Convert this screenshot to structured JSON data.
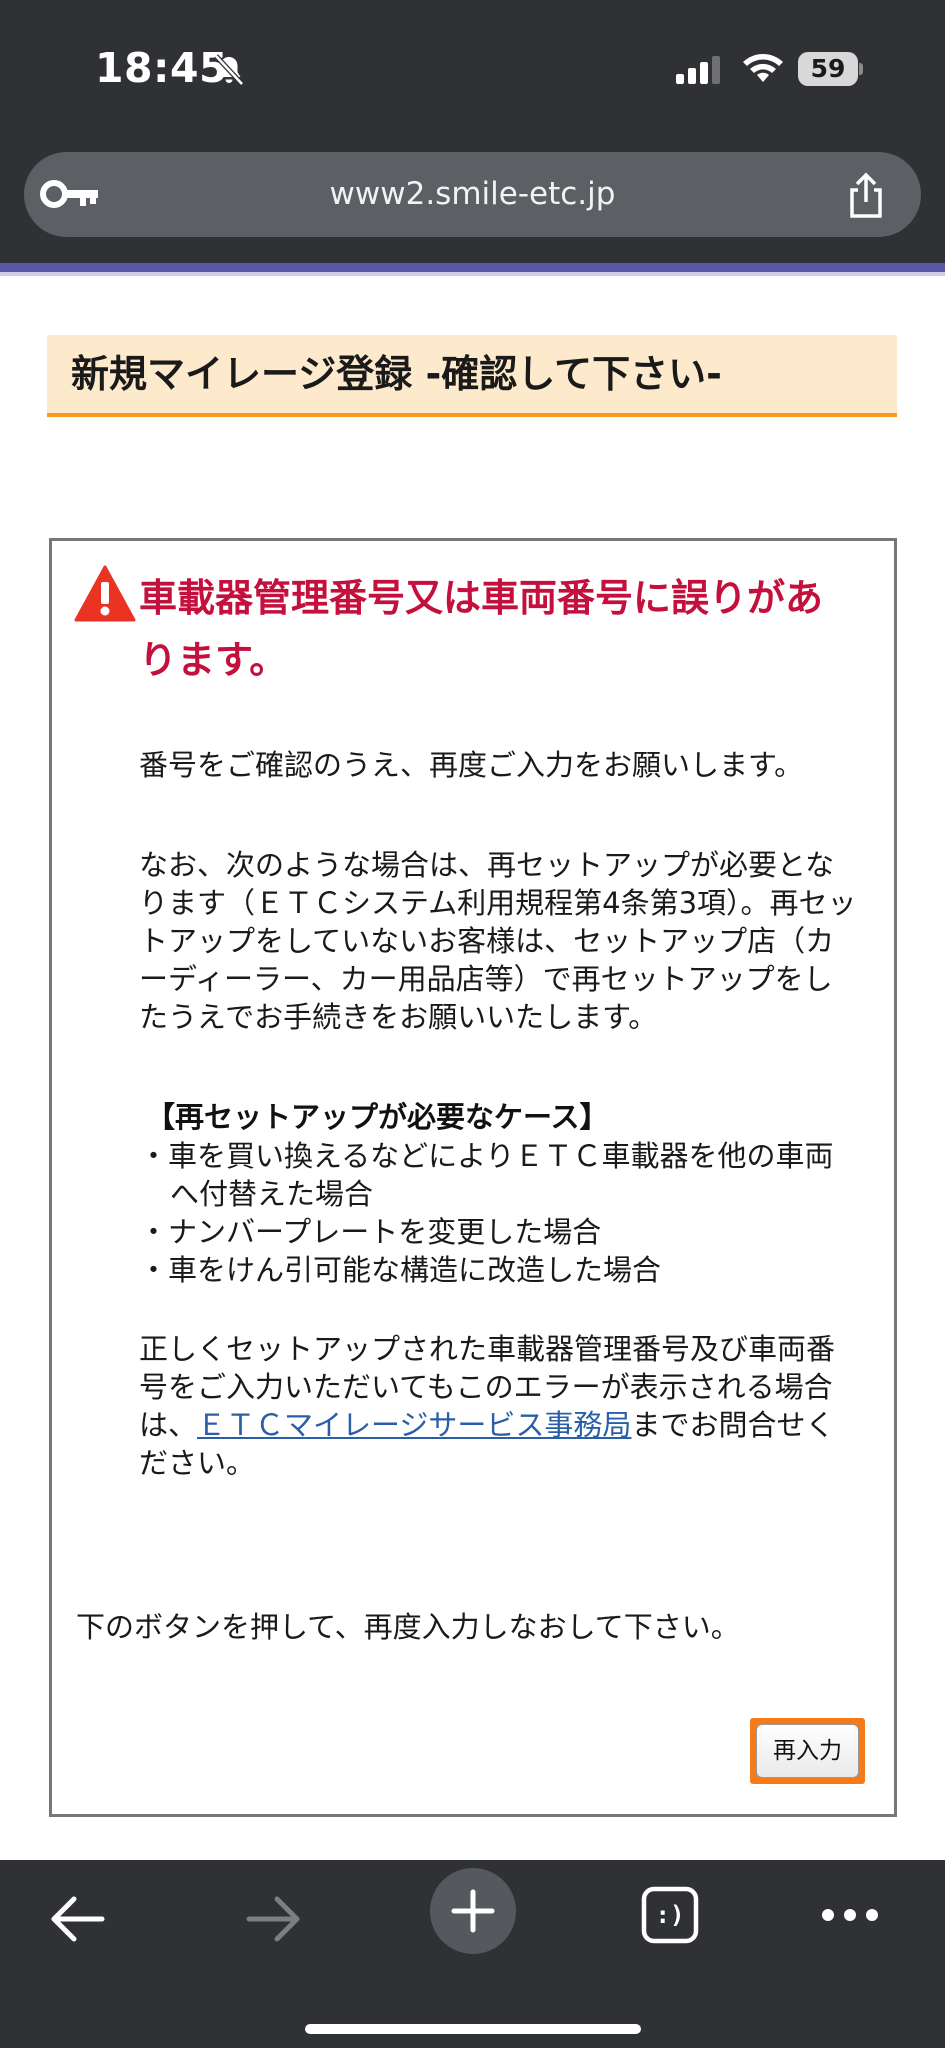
{
  "status_bar": {
    "time": "18:45",
    "battery_level": "59",
    "icons": [
      "bell-slash-icon",
      "signal-icon",
      "wifi-icon",
      "battery-icon"
    ]
  },
  "browser": {
    "url": "www2.smile-etc.jp",
    "icons": [
      "key-icon",
      "share-icon"
    ]
  },
  "page": {
    "title": "新規マイレージ登録 -確認して下さい-",
    "error": {
      "title": "車載器管理番号又は車両番号に誤りがあります。",
      "p1": "番号をご確認のうえ、再度ご入力をお願いします。",
      "p2": "なお、次のような場合は、再セットアップが必要となります（ＥＴＣシステム利用規程第4条第3項）。再セットアップをしていないお客様は、セットアップ店（カーディーラー、カー用品店等）で再セットアップをしたうえでお手続きをお願いいたします。",
      "case_heading": "【再セットアップが必要なケース】",
      "cases": [
        "・車を買い換えるなどによりＥＴＣ車載器を他の車両へ付替えた場合",
        "・ナンバープレートを変更した場合",
        "・車をけん引可能な構造に改造した場合"
      ],
      "p3_before": "正しくセットアップされた車載器管理番号及び車両番号をご入力いただいてもこのエラーが表示される場合は、",
      "p3_link": "ＥＴＣマイレージサービス事務局",
      "p3_after": "までお問合せください。"
    },
    "instruction": "下のボタンを押して、再度入力しなおして下さい。",
    "reenter_button": "再入力"
  },
  "toolbar": {
    "tabs_glyph": ":)",
    "icons": [
      "back-arrow-icon",
      "forward-arrow-icon",
      "plus-icon",
      "tabs-icon",
      "more-icon"
    ]
  },
  "colors": {
    "chrome": "#2f3134",
    "title_bg": "#fde9cc",
    "title_underline": "#f39a1f",
    "error_red": "#c4103c",
    "link": "#2a5fa8",
    "button_highlight": "#f47a1a"
  }
}
